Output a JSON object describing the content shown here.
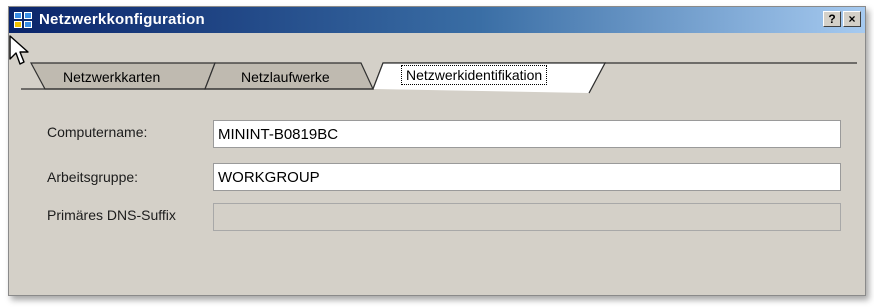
{
  "window": {
    "title": "Netzwerkkonfiguration",
    "help_label": "?",
    "close_label": "×"
  },
  "tabs": [
    {
      "label": "Netzwerkkarten",
      "active": false
    },
    {
      "label": "Netzlaufwerke",
      "active": false
    },
    {
      "label": "Netzwerkidentifikation",
      "active": true
    }
  ],
  "form": {
    "computername": {
      "label": "Computername:",
      "value": "MININT-B0819BC"
    },
    "workgroup": {
      "label": "Arbeitsgruppe:",
      "value": "WORKGROUP"
    },
    "dns_suffix": {
      "label": "Primäres DNS-Suffix",
      "value": "",
      "enabled": false
    }
  },
  "colors": {
    "titlebar_start": "#0a246a",
    "titlebar_end": "#a6caf0",
    "window_bg": "#d4d0c8"
  },
  "icons": {
    "app": "network-config-icon",
    "cursor": "mouse-pointer-icon"
  }
}
